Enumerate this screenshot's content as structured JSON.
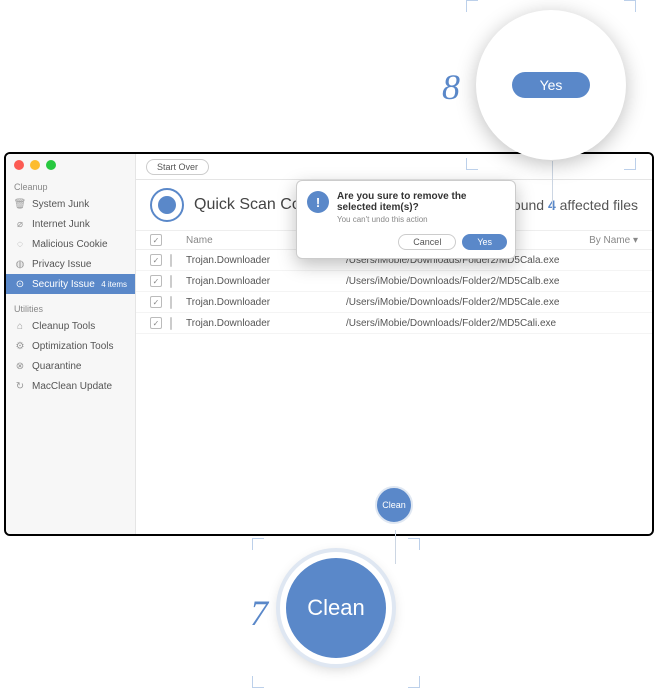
{
  "annotations": {
    "yes": {
      "number": "8",
      "label": "Yes"
    },
    "clean": {
      "number": "7",
      "label": "Clean"
    }
  },
  "sidebar": {
    "sections": {
      "cleanup": {
        "header": "Cleanup",
        "items": [
          {
            "label": "System Junk"
          },
          {
            "label": "Internet Junk"
          },
          {
            "label": "Malicious Cookie"
          },
          {
            "label": "Privacy Issue"
          },
          {
            "label": "Security Issue",
            "badge": "4 items",
            "selected": true
          }
        ]
      },
      "utilities": {
        "header": "Utilities",
        "items": [
          {
            "label": "Cleanup Tools"
          },
          {
            "label": "Optimization Tools"
          },
          {
            "label": "Quarantine"
          },
          {
            "label": "MacClean Update"
          }
        ]
      }
    }
  },
  "toolbar": {
    "start_over": "Start Over"
  },
  "header": {
    "title": "Quick Scan Co",
    "found_prefix": "Found ",
    "found_count": "4",
    "found_suffix": " affected files"
  },
  "table": {
    "columns": {
      "name": "Name",
      "sort": "By Name ▾"
    },
    "rows": [
      {
        "name": "Trojan.Downloader",
        "path": "/Users/iMobie/Downloads/Folder2/MD5Cala.exe"
      },
      {
        "name": "Trojan.Downloader",
        "path": "/Users/iMobie/Downloads/Folder2/MD5Calb.exe"
      },
      {
        "name": "Trojan.Downloader",
        "path": "/Users/iMobie/Downloads/Folder2/MD5Cale.exe"
      },
      {
        "name": "Trojan.Downloader",
        "path": "/Users/iMobie/Downloads/Folder2/MD5Cali.exe"
      }
    ]
  },
  "dialog": {
    "title": "Are you sure to remove the selected item(s)?",
    "subtitle": "You can't undo this action",
    "cancel": "Cancel",
    "yes": "Yes"
  },
  "clean_button": "Clean"
}
